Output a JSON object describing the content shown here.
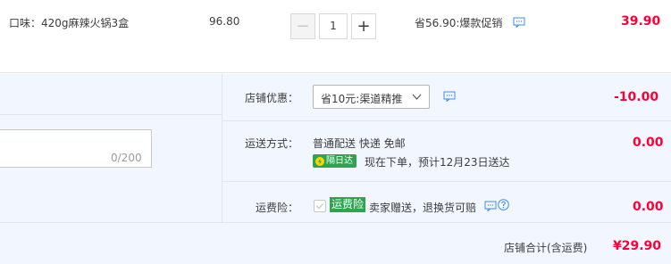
{
  "item": {
    "flavor": "口味：420g麻辣火锅3盒",
    "unit_price": "96.80",
    "quantity": "1",
    "minus_symbol": "−",
    "plus_symbol": "+",
    "promo_text": "省56.90:爆款促销",
    "subtotal": "39.90"
  },
  "memo": {
    "char_count": "0/200"
  },
  "shop_discount": {
    "label": "店铺优惠：",
    "selected": "省10元:渠道精推",
    "amount": "-10.00"
  },
  "shipping": {
    "label": "运送方式：",
    "method": "普通配送 快递 免邮",
    "badge": "隔日达",
    "eta": "现在下单，预计12月23日送达",
    "amount": "0.00"
  },
  "insurance": {
    "label": "运费险：",
    "badge": "运费险",
    "text": "卖家赠送，退换货可赔",
    "amount": "0.00"
  },
  "total": {
    "label": "店铺合计(含运费)",
    "amount": "¥29.90"
  },
  "colors": {
    "price_red": "#ff0036",
    "badge_green": "#2ca54f",
    "panel_bg": "#f2f7ff",
    "icon_blue": "#3d8ee8"
  },
  "icons": [
    "chat-bubble-icon",
    "chevron-down-icon",
    "bolt-icon",
    "question-icon",
    "checkbox-icon"
  ]
}
